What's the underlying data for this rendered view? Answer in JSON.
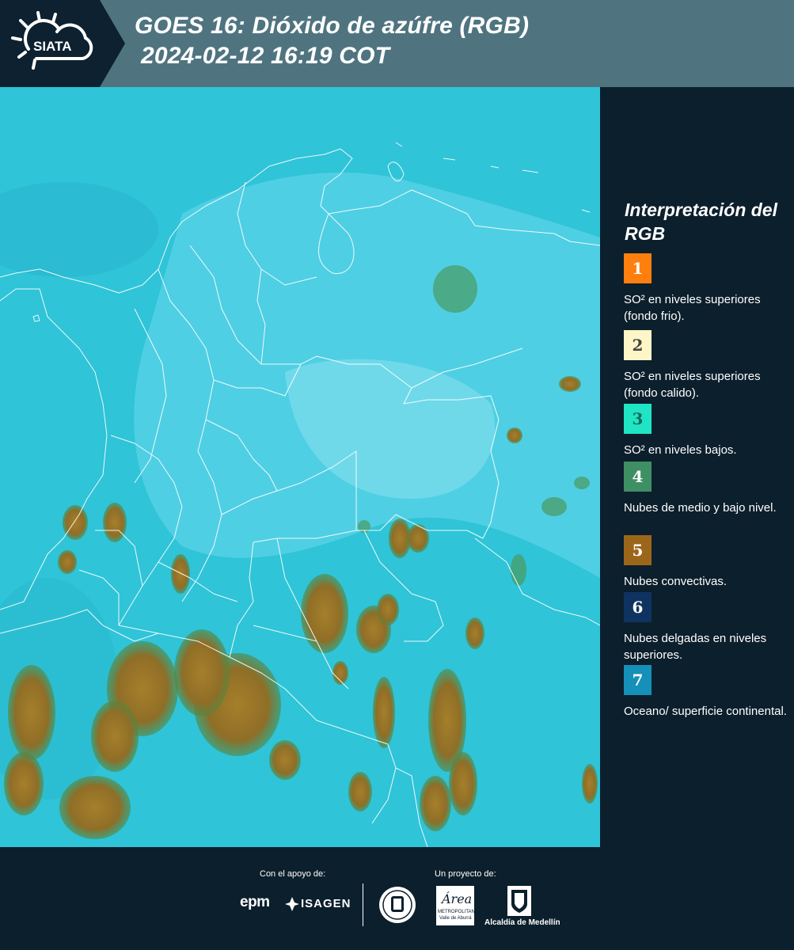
{
  "header": {
    "logo_text": "SIATA",
    "title_line1": "GOES 16: Dióxido de azúfre (RGB)",
    "title_line2": "2024-02-12 16:19 COT"
  },
  "legend": {
    "title": "Interpretación del RGB",
    "items": [
      {
        "number": "1",
        "color": "#ff7f0e",
        "text_color": "#ffffff",
        "text": "SO² en niveles superiores (fondo frio)."
      },
      {
        "number": "2",
        "color": "#fef6c6",
        "text_color": "#444444",
        "text": "SO² en niveles superiores (fondo calido)."
      },
      {
        "number": "3",
        "color": "#1fe5c5",
        "text_color": "#146a5a",
        "text": "SO² en niveles bajos."
      },
      {
        "number": "4",
        "color": "#3f8f64",
        "text_color": "#ffffff",
        "text": "Nubes de medio y bajo nivel."
      },
      {
        "number": "5",
        "color": "#9c661a",
        "text_color": "#ffffff",
        "text": "Nubes convectivas."
      },
      {
        "number": "6",
        "color": "#0f3360",
        "text_color": "#ffffff",
        "text": "Nubes delgadas en niveles superiores."
      },
      {
        "number": "7",
        "color": "#1490b9",
        "text_color": "#ffffff",
        "text": "Oceano/ superficie continental."
      }
    ]
  },
  "map": {
    "sky_color": "#2ec6d9",
    "land_color": "#63d8ec",
    "cloud_color": "#9c7a2a",
    "border_color": "#ffffff"
  },
  "footer": {
    "support_label": "Con el apoyo de:",
    "project_label": "Un proyecto de:",
    "epm_text": "epm",
    "isagen_text": "ISAGEN",
    "area_text": "Área",
    "area_sub1": "METROPOLITANA",
    "area_sub2": "Valle de Aburrá",
    "alcaldia_text": "Alcaldía de Medellín"
  }
}
